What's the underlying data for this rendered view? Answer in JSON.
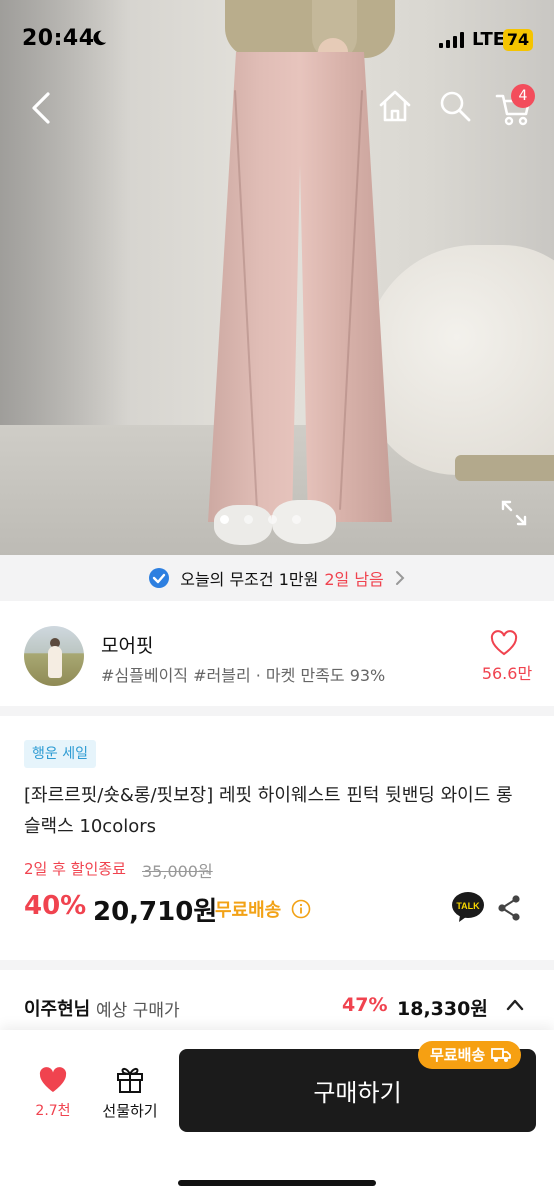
{
  "status_bar": {
    "time": "20:44",
    "network": "LTE",
    "battery": "74"
  },
  "nav": {
    "back_icon": "chevron-left-icon",
    "home_icon": "home-icon",
    "search_icon": "search-icon",
    "cart_icon": "cart-icon",
    "cart_count": "4"
  },
  "gallery": {
    "pages": 4,
    "active_index": 0,
    "expand_icon": "expand-icon"
  },
  "coupon_banner": {
    "text": "오늘의 무조건 1만원",
    "remaining": "2일 남음"
  },
  "store": {
    "name": "모어핏",
    "tags": "#심플베이직 #러블리 · 마켓 만족도 93%",
    "likes": "56.6만"
  },
  "product": {
    "badge": "행운 세일",
    "title": "[좌르르핏/숏&롱/핏보장] 레핏 하이웨스트 핀턱 뒷밴딩 와이드 롱 슬랙스 10colors",
    "sale_end": "2일 후 할인종료",
    "original_price": "35,000원",
    "discount": "40%",
    "price": "20,710원",
    "shipping": "무료배송",
    "talk_label": "TALK"
  },
  "expected_price": {
    "user": "이주현님",
    "label": "예상 구매가",
    "discount": "47%",
    "price": "18,330원"
  },
  "bottom_bar": {
    "like_count": "2.7천",
    "gift_label": "선물하기",
    "buy_label": "구매하기",
    "shipping_tag": "무료배송"
  },
  "colors": {
    "accent_red": "#f0434f",
    "shipping_orange": "#f6a012",
    "buy_button": "#1b1b1b",
    "badge_blue": "#2d9bd3"
  }
}
